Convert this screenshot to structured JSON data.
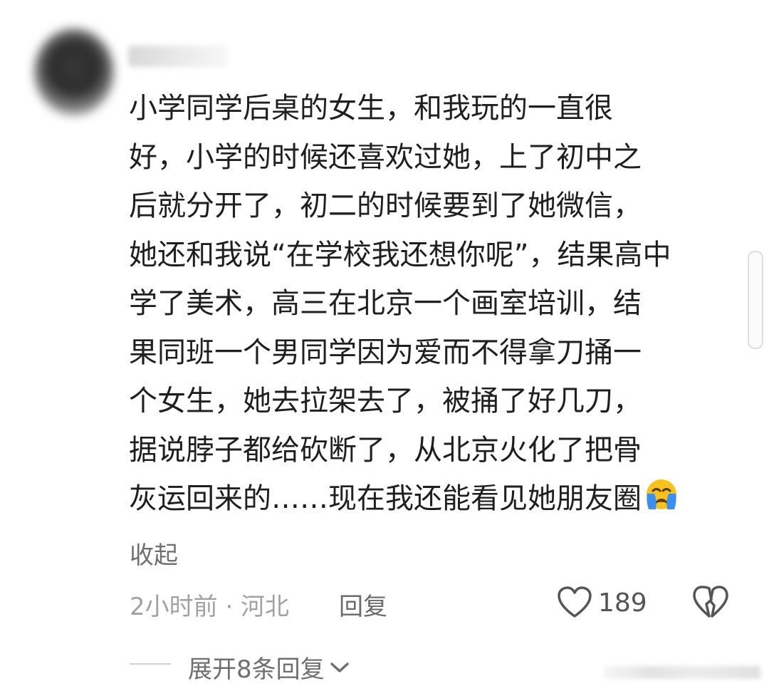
{
  "comment": {
    "text": "小学同学后桌的女生，和我玩的一直很\n好，小学的时候还喜欢过她，上了初中之\n后就分开了，初二的时候要到了她微信，\n她还和我说“在学校我还想你呢”，结果高中\n学了美术，高三在北京一个画室培训，结\n果同班一个男同学因为爱而不得拿刀捅一\n个女生，她去拉架去了，被捅了好几刀，\n据说脖子都给砍断了，从北京火化了把骨\n灰运回来的……现在我还能看见她朋友圈",
    "emoji": "crying-face-icon",
    "collapse_label": "收起"
  },
  "meta": {
    "time_location": "2小时前 · 河北",
    "reply_label": "回复",
    "like_count": "189"
  },
  "replies": {
    "expand_label": "展开8条回复"
  },
  "colors": {
    "primary_text": "#1f1f1f",
    "secondary_text": "#6f6f6f",
    "meta_text": "#a2a2a2",
    "emoji_yellow": "#f7c21d",
    "emoji_tears": "#3a8ff0"
  }
}
